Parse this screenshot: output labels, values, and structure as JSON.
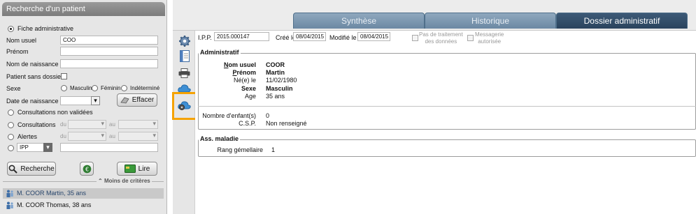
{
  "search_panel": {
    "title": "Recherche d'un patient",
    "fiche_admin_label": "Fiche administrative",
    "nom_usuel_label": "Nom usuel",
    "nom_usuel_value": "COO",
    "prenom_label": "Prénom",
    "nom_naissance_label": "Nom de naissance",
    "sans_dossier_label": "Patient sans dossier",
    "sexe_label": "Sexe",
    "sexe_options": [
      "Masculin",
      "Féminin",
      "Indéterminé"
    ],
    "date_naissance_label": "Date de naissance",
    "effacer_label": "Effacer",
    "consult_non_validees_label": "Consultations non validées",
    "consultations_label": "Consultations",
    "alertes_label": "Alertes",
    "du_label": "du",
    "au_label": "au",
    "ipp_label": "IPP",
    "recherche_label": "Recherche",
    "lire_label": "Lire",
    "moins_criteres_label": "Moins de critères",
    "results": [
      "M. COOR Martin, 35 ans",
      "M. COOR Thomas, 38 ans"
    ]
  },
  "tabs": [
    {
      "label": "Synthèse"
    },
    {
      "label": "Historique"
    },
    {
      "label": "Dossier administratif"
    }
  ],
  "header_fields": {
    "ipp_label": "I.P.P.",
    "ipp_value": "2015.000147",
    "cree_label": "Créé le",
    "cree_value": "08/04/2015",
    "modifie_label": "Modifié le",
    "modifie_value": "08/04/2015",
    "pas_traitement_line1": "Pas de traitement",
    "pas_traitement_line2": "des données",
    "messagerie_line1": "Messagerie",
    "messagerie_line2": "autorisée"
  },
  "administratif": {
    "title": "Administratif",
    "nom_label": "Nom usuel",
    "nom_value": "COOR",
    "prenom_label": "Prénom",
    "prenom_value": "Martin",
    "ne_label": "Né(e) le",
    "ne_value": "11/02/1980",
    "sexe_label": "Sexe",
    "sexe_value": "Masculin",
    "age_label": "Age",
    "age_value": "35 ans",
    "enfants_label": "Nombre d'enfant(s)",
    "enfants_value": "0",
    "csp_label": "C.S.P.",
    "csp_value": "Non renseigné"
  },
  "ass_maladie": {
    "title": "Ass. maladie",
    "rang_label": "Rang gémellaire",
    "rang_value": "1"
  },
  "colors": {
    "tab_active": "#2a435d",
    "tab_inactive": "#7a94ad",
    "highlight": "#f5a200"
  },
  "icons": [
    "gear-icon",
    "document-icon",
    "printer-icon",
    "cloud-icon",
    "cloud-settings-icon"
  ]
}
